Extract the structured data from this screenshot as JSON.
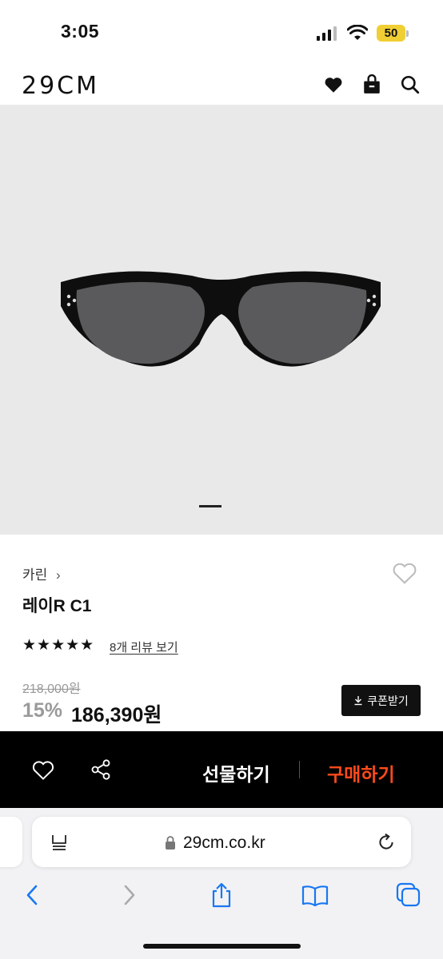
{
  "status_bar": {
    "time": "3:05",
    "battery": "50"
  },
  "header": {
    "logo": "29CM"
  },
  "product": {
    "brand": "카린",
    "brand_chevron": "›",
    "name": "레이R C1",
    "rating_stars": "★★★★★",
    "review_link": "8개 리뷰 보기",
    "original_price": "218,000원",
    "discount": "15%",
    "price": "186,390원",
    "coupon_label": "쿠폰받기",
    "image_pager": {
      "count": 1,
      "active": 0
    }
  },
  "buy_bar": {
    "gift_label": "선물하기",
    "buy_label": "구매하기",
    "buy_color": "#ff4a1c"
  },
  "browser": {
    "url": "29cm.co.kr"
  },
  "icons": [
    "signal-icon",
    "wifi-icon",
    "heart-icon",
    "bag-icon",
    "search-icon",
    "heart-outline-icon",
    "share-icon",
    "reader-icon",
    "lock-icon",
    "reload-icon",
    "back-icon",
    "forward-icon",
    "share-sheet-icon",
    "bookmarks-icon",
    "tabs-icon",
    "download-icon"
  ]
}
